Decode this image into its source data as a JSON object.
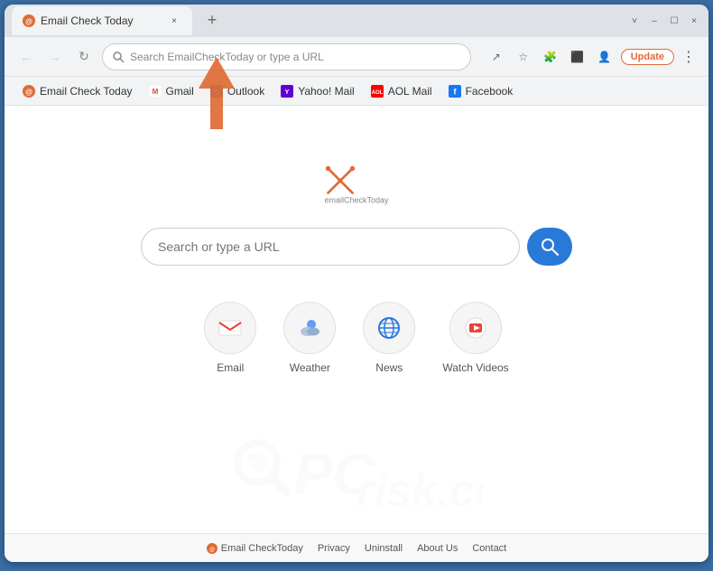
{
  "browser": {
    "tab": {
      "favicon": "📧",
      "title": "Email Check Today",
      "close": "×"
    },
    "new_tab": "+",
    "nav": {
      "back": "←",
      "forward": "→",
      "refresh": "↻"
    },
    "url_placeholder": "Search EmailCheckToday or type a URL",
    "actions": {
      "share": "↗",
      "bookmark": "☆",
      "extensions": "🧩",
      "sidebar": "⬛",
      "profile": "👤",
      "update": "Update",
      "menu": "⋮"
    },
    "window_controls": {
      "minimize": "–",
      "maximize": "☐",
      "close": "×",
      "chevron": "˅"
    }
  },
  "bookmarks": [
    {
      "id": "emailchecktoday",
      "favicon": "📧",
      "label": "Email Check Today"
    },
    {
      "id": "gmail",
      "favicon": "M",
      "label": "Gmail"
    },
    {
      "id": "outlook",
      "favicon": "📮",
      "label": "Outlook"
    },
    {
      "id": "yahoomail",
      "favicon": "Y",
      "label": "Yahoo! Mail"
    },
    {
      "id": "aolmail",
      "favicon": "A",
      "label": "AOL Mail"
    },
    {
      "id": "facebook",
      "favicon": "f",
      "label": "Facebook"
    }
  ],
  "page": {
    "logo_text": "emailCheckToday",
    "search_placeholder": "Search or type a URL",
    "search_button_icon": "🔍",
    "quick_links": [
      {
        "id": "email",
        "icon": "M",
        "label": "Email",
        "color": "#ea4335"
      },
      {
        "id": "weather",
        "icon": "☁",
        "label": "Weather",
        "color": "#4285f4"
      },
      {
        "id": "news",
        "icon": "🌐",
        "label": "News",
        "color": "#2979d9"
      },
      {
        "id": "watch_videos",
        "icon": "▶",
        "label": "Watch Videos",
        "color": "#ea4335"
      }
    ],
    "footer_links": [
      {
        "id": "emailchecktoday-footer",
        "label": "Email CheckToday"
      },
      {
        "id": "privacy",
        "label": "Privacy"
      },
      {
        "id": "uninstall",
        "label": "Uninstall"
      },
      {
        "id": "about-us",
        "label": "About Us"
      },
      {
        "id": "contact",
        "label": "Contact"
      }
    ]
  },
  "watermark": {
    "pc": "PC",
    "risk": "risk.com"
  }
}
